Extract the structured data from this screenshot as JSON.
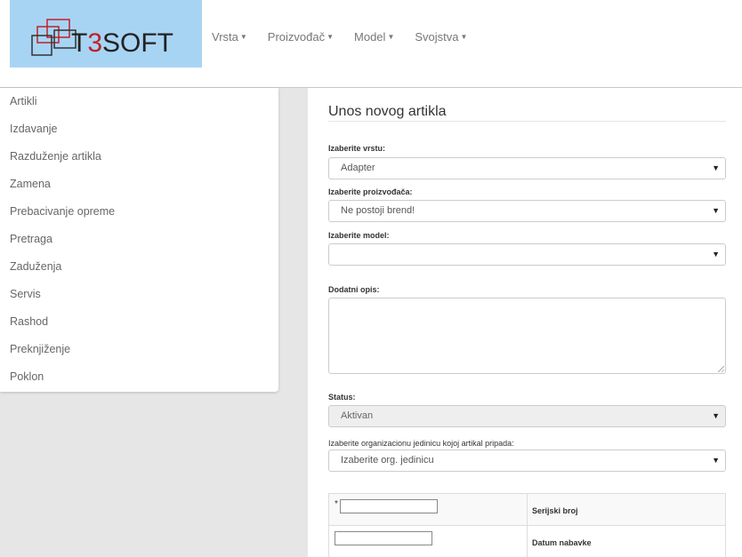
{
  "logo": {
    "text_prefix": "T",
    "text_highlight": "3",
    "text_suffix": "SOFT",
    "accent_color": "#c0202a"
  },
  "nav": {
    "items": [
      {
        "label": "Vrsta"
      },
      {
        "label": "Proizvođač"
      },
      {
        "label": "Model"
      },
      {
        "label": "Svojstva"
      }
    ],
    "caret": "▼"
  },
  "sidebar": {
    "items": [
      {
        "label": "Artikli"
      },
      {
        "label": "Izdavanje"
      },
      {
        "label": "Razduženje artikla"
      },
      {
        "label": "Zamena"
      },
      {
        "label": "Prebacivanje opreme"
      },
      {
        "label": "Pretraga"
      },
      {
        "label": "Zaduženja"
      },
      {
        "label": "Servis"
      },
      {
        "label": "Rashod"
      },
      {
        "label": "Preknjiženje"
      },
      {
        "label": "Poklon"
      }
    ]
  },
  "form": {
    "title": "Unos novog artikla",
    "vrsta": {
      "label": "Izaberite vrstu:",
      "value": "Adapter"
    },
    "proizvodjac": {
      "label": "Izaberite proizvođača:",
      "value": "Ne postoji brend!"
    },
    "model": {
      "label": "Izaberite model:",
      "value": ""
    },
    "opis": {
      "label": "Dodatni opis:"
    },
    "status": {
      "label": "Status:",
      "value": "Aktivan"
    },
    "org": {
      "label": "Izaberite organizacionu jedinicu kojoj artikal pripada:",
      "value": "Izaberite org. jedinicu"
    },
    "select_arrow": "▼",
    "table": {
      "rows": [
        {
          "required": "*",
          "label": "Serijski broj",
          "value": ""
        },
        {
          "required": "",
          "label": "Datum nabavke",
          "value": ""
        }
      ]
    }
  }
}
